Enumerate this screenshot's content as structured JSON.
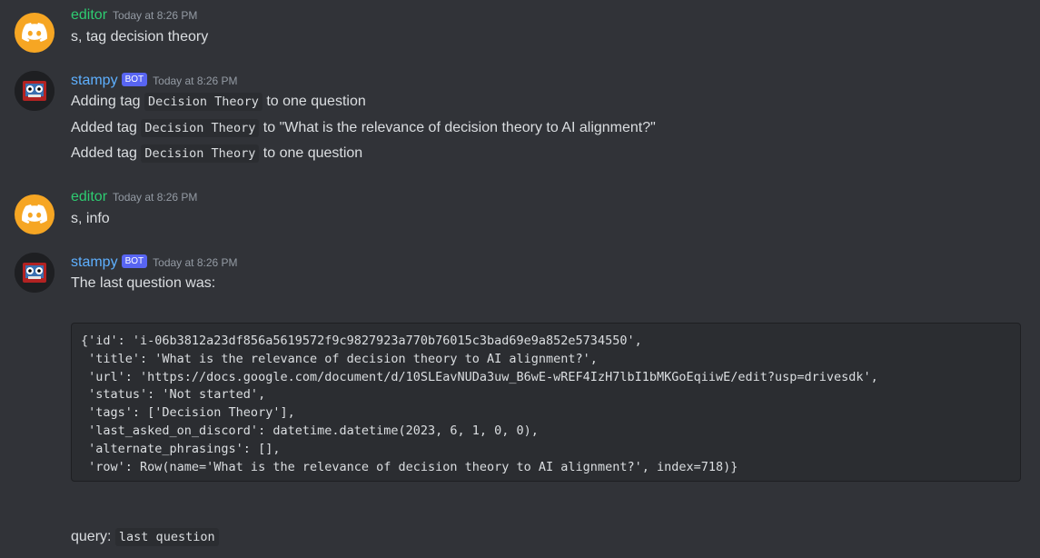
{
  "messages": [
    {
      "author": "editor",
      "timestamp": "Today at 8:26 PM",
      "lines": [
        "s, tag decision theory"
      ]
    },
    {
      "author": "stampy",
      "badge": "BOT",
      "timestamp": "Today at 8:26 PM",
      "lines": [
        {
          "pre": "Adding tag ",
          "code": "Decision Theory",
          "post": " to one question"
        },
        {
          "pre": "Added tag ",
          "code": "Decision Theory",
          "post": " to \"What is the relevance of decision theory to AI alignment?\""
        },
        {
          "pre": "Added tag ",
          "code": "Decision Theory",
          "post": " to one question"
        }
      ]
    },
    {
      "author": "editor",
      "timestamp": "Today at 8:26 PM",
      "lines": [
        "s, info"
      ]
    },
    {
      "author": "stampy",
      "badge": "BOT",
      "timestamp": "Today at 8:26 PM",
      "lines": [
        "The last question was:"
      ],
      "code_block": "{'id': 'i-06b3812a23df856a5619572f9c9827923a770b76015c3bad69e9a852e5734550',\n 'title': 'What is the relevance of decision theory to AI alignment?',\n 'url': 'https://docs.google.com/document/d/10SLEavNUDa3uw_B6wE-wREF4IzH7lbI1bMKGoEqiiwE/edit?usp=drivesdk',\n 'status': 'Not started',\n 'tags': ['Decision Theory'],\n 'last_asked_on_discord': datetime.datetime(2023, 6, 1, 0, 0),\n 'alternate_phrasings': [],\n 'row': Row(name='What is the relevance of decision theory to AI alignment?', index=718)}",
      "query_label": "query:",
      "query_code": "last question"
    }
  ],
  "colors": {
    "background": "#313338",
    "editor_name": "#2ecc71",
    "bot_name": "#5eb0ff",
    "bot_badge": "#5865f2",
    "editor_avatar": "#f6a623"
  },
  "icons": {
    "editor_avatar": "discord-logo-icon",
    "stampy_avatar": "stampy-robot-avatar"
  }
}
